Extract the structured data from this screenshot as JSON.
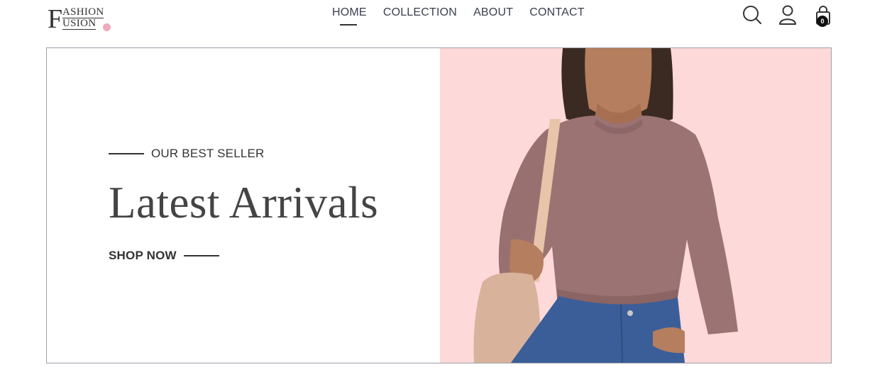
{
  "brand": {
    "logo_letter_f": "F",
    "logo_ashion": "ASHION",
    "logo_letter_u": "F",
    "logo_usion": "USION",
    "dot_color": "#f0a8bd"
  },
  "nav": {
    "items": [
      {
        "label": "HOME",
        "active": true
      },
      {
        "label": "COLLECTION",
        "active": false
      },
      {
        "label": "ABOUT",
        "active": false
      },
      {
        "label": "CONTACT",
        "active": false
      }
    ]
  },
  "header_icons": {
    "search": "search-icon",
    "account": "user-icon",
    "cart": "shopping-bag-icon",
    "cart_count": "0"
  },
  "hero": {
    "eyebrow": "OUR BEST SELLER",
    "headline": "Latest Arrivals",
    "cta": "SHOP NOW",
    "image_bg": "#fdd9da"
  }
}
